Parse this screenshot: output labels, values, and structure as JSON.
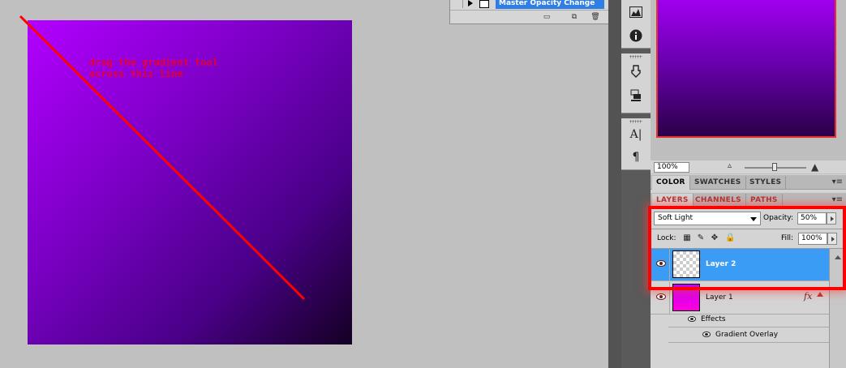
{
  "canvas": {
    "note_line1": "drag the gradient tool",
    "note_line2": "across this line",
    "gradient_colors": [
      "#b300ff",
      "#7a00c4",
      "#4a0088",
      "#140024"
    ],
    "annotation_color": "#ff0000"
  },
  "actions": {
    "selected_item": "Master Opacity Change"
  },
  "dock": {
    "icons": [
      "histogram-icon",
      "info-icon",
      "brush-presets-icon",
      "clone-source-icon",
      "character-icon",
      "paragraph-icon"
    ]
  },
  "navigator": {
    "zoom": "100%"
  },
  "color_tabs": [
    "COLOR",
    "SWATCHES",
    "STYLES"
  ],
  "layers_tabs": [
    "LAYERS",
    "CHANNELS",
    "PATHS"
  ],
  "layers": {
    "blend_mode": "Soft Light",
    "opacity_label": "Opacity:",
    "opacity_value": "50%",
    "lock_label": "Lock:",
    "fill_label": "Fill:",
    "fill_value": "100%",
    "items": [
      {
        "name": "Layer 2",
        "selected": true
      },
      {
        "name": "Layer 1",
        "selected": false
      }
    ],
    "fx_symbol": "fx",
    "effects_label": "Effects",
    "effect_item": "Gradient Overlay"
  },
  "colors": {
    "selection": "#3a9cf5",
    "highlight": "#ff0000"
  }
}
